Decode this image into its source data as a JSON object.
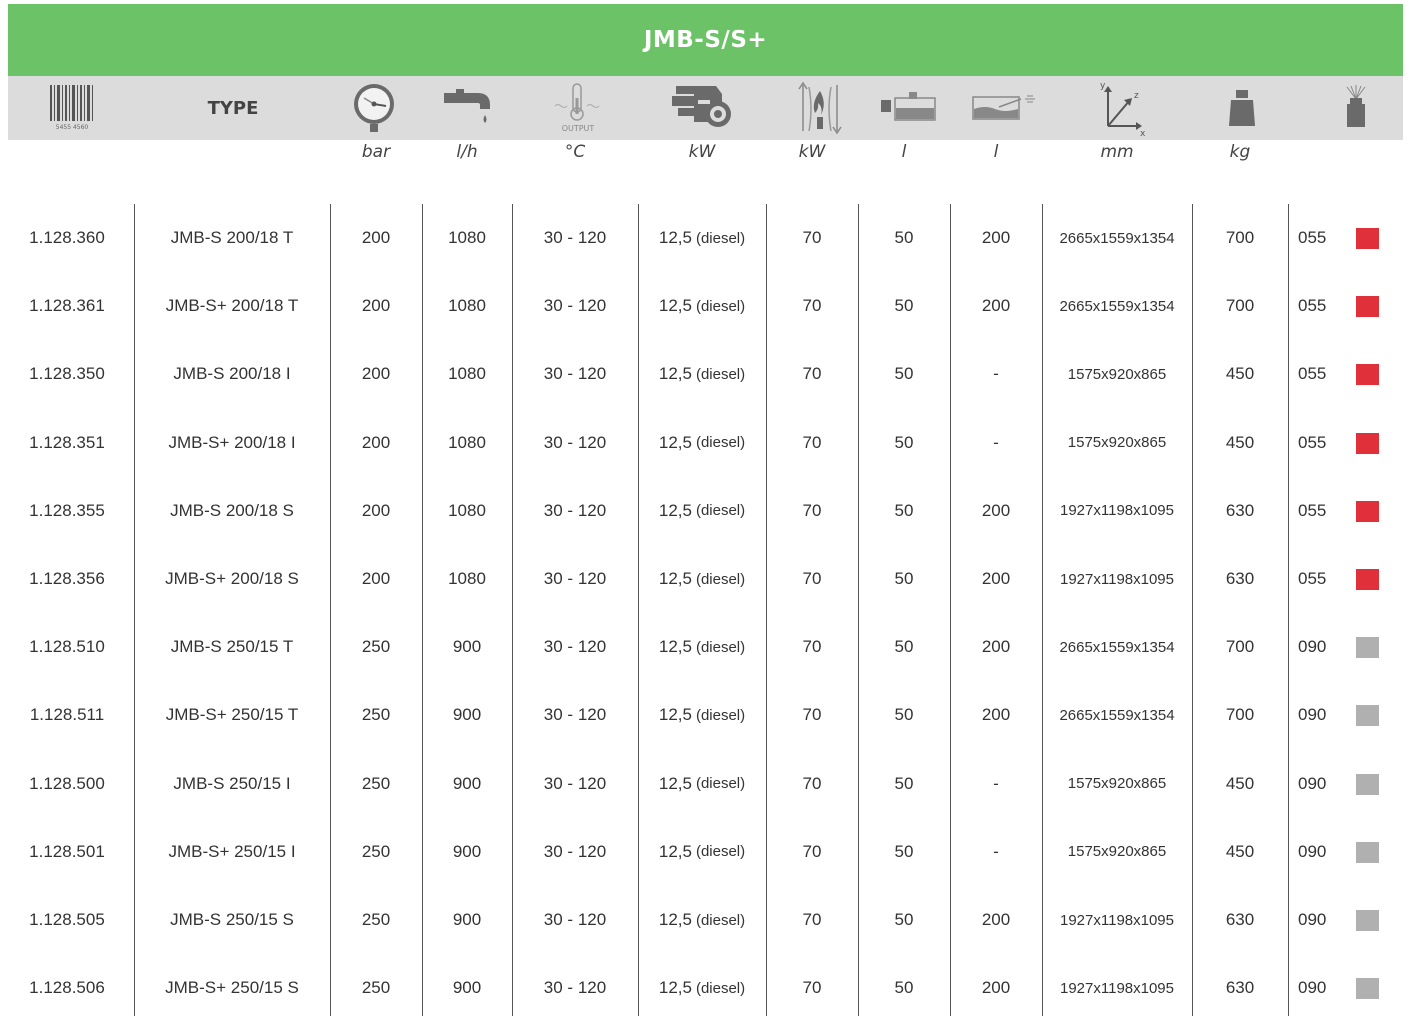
{
  "title": "JMB-S/S+",
  "header": {
    "type_label": "TYPE",
    "barcode_number": "5455 4560",
    "output_label": "OUTPUT",
    "axis_y": "y",
    "axis_z": "z",
    "axis_x": "x",
    "icons": [
      "barcode-icon",
      "pressure-gauge-icon",
      "water-tap-icon",
      "thermometer-icon",
      "engine-icon",
      "heater-icon",
      "fuel-tank-icon",
      "water-tank-icon",
      "dimensions-icon",
      "weight-icon",
      "nozzle-icon"
    ]
  },
  "units": [
    "bar",
    "l/h",
    "°C",
    "kW",
    "kW",
    "l",
    "l",
    "mm",
    "kg"
  ],
  "colors": {
    "header_green": "#6cc267",
    "icon_row_bg": "#dcdcdc",
    "red": "#e0313a",
    "grey": "#b0b0b0"
  },
  "rows": [
    {
      "article": "1.128.360",
      "type": "JMB-S 200/18 T",
      "bar": "200",
      "lh": "1080",
      "temp": "30 - 120",
      "kw": "12,5",
      "fuel": "(diesel)",
      "kw2": "70",
      "l1": "50",
      "l2": "200",
      "dim": "2665x1559x1354",
      "kg": "700",
      "nozzle": "055",
      "color": "red"
    },
    {
      "article": "1.128.361",
      "type": "JMB-S+ 200/18 T",
      "bar": "200",
      "lh": "1080",
      "temp": "30 - 120",
      "kw": "12,5",
      "fuel": "(diesel)",
      "kw2": "70",
      "l1": "50",
      "l2": "200",
      "dim": "2665x1559x1354",
      "kg": "700",
      "nozzle": "055",
      "color": "red"
    },
    {
      "article": "1.128.350",
      "type": "JMB-S 200/18 I",
      "bar": "200",
      "lh": "1080",
      "temp": "30 - 120",
      "kw": "12,5",
      "fuel": "(diesel)",
      "kw2": "70",
      "l1": "50",
      "l2": "-",
      "dim": "1575x920x865",
      "kg": "450",
      "nozzle": "055",
      "color": "red"
    },
    {
      "article": "1.128.351",
      "type": "JMB-S+ 200/18 I",
      "bar": "200",
      "lh": "1080",
      "temp": "30 - 120",
      "kw": "12,5",
      "fuel": "(diesel)",
      "kw2": "70",
      "l1": "50",
      "l2": "-",
      "dim": "1575x920x865",
      "kg": "450",
      "nozzle": "055",
      "color": "red"
    },
    {
      "article": "1.128.355",
      "type": "JMB-S 200/18 S",
      "bar": "200",
      "lh": "1080",
      "temp": "30 - 120",
      "kw": "12,5",
      "fuel": "(diesel)",
      "kw2": "70",
      "l1": "50",
      "l2": "200",
      "dim": "1927x1198x1095",
      "kg": "630",
      "nozzle": "055",
      "color": "red"
    },
    {
      "article": "1.128.356",
      "type": "JMB-S+ 200/18 S",
      "bar": "200",
      "lh": "1080",
      "temp": "30 - 120",
      "kw": "12,5",
      "fuel": "(diesel)",
      "kw2": "70",
      "l1": "50",
      "l2": "200",
      "dim": "1927x1198x1095",
      "kg": "630",
      "nozzle": "055",
      "color": "red"
    },
    {
      "article": "1.128.510",
      "type": "JMB-S 250/15 T",
      "bar": "250",
      "lh": "900",
      "temp": "30 - 120",
      "kw": "12,5",
      "fuel": "(diesel)",
      "kw2": "70",
      "l1": "50",
      "l2": "200",
      "dim": "2665x1559x1354",
      "kg": "700",
      "nozzle": "090",
      "color": "grey"
    },
    {
      "article": "1.128.511",
      "type": "JMB-S+ 250/15 T",
      "bar": "250",
      "lh": "900",
      "temp": "30 - 120",
      "kw": "12,5",
      "fuel": "(diesel)",
      "kw2": "70",
      "l1": "50",
      "l2": "200",
      "dim": "2665x1559x1354",
      "kg": "700",
      "nozzle": "090",
      "color": "grey"
    },
    {
      "article": "1.128.500",
      "type": "JMB-S 250/15 I",
      "bar": "250",
      "lh": "900",
      "temp": "30 - 120",
      "kw": "12,5",
      "fuel": "(diesel)",
      "kw2": "70",
      "l1": "50",
      "l2": "-",
      "dim": "1575x920x865",
      "kg": "450",
      "nozzle": "090",
      "color": "grey"
    },
    {
      "article": "1.128.501",
      "type": "JMB-S+ 250/15 I",
      "bar": "250",
      "lh": "900",
      "temp": "30 - 120",
      "kw": "12,5",
      "fuel": "(diesel)",
      "kw2": "70",
      "l1": "50",
      "l2": "-",
      "dim": "1575x920x865",
      "kg": "450",
      "nozzle": "090",
      "color": "grey"
    },
    {
      "article": "1.128.505",
      "type": "JMB-S 250/15 S",
      "bar": "250",
      "lh": "900",
      "temp": "30 - 120",
      "kw": "12,5",
      "fuel": "(diesel)",
      "kw2": "70",
      "l1": "50",
      "l2": "200",
      "dim": "1927x1198x1095",
      "kg": "630",
      "nozzle": "090",
      "color": "grey"
    },
    {
      "article": "1.128.506",
      "type": "JMB-S+ 250/15 S",
      "bar": "250",
      "lh": "900",
      "temp": "30 - 120",
      "kw": "12,5",
      "fuel": "(diesel)",
      "kw2": "70",
      "l1": "50",
      "l2": "200",
      "dim": "1927x1198x1095",
      "kg": "630",
      "nozzle": "090",
      "color": "grey"
    }
  ]
}
